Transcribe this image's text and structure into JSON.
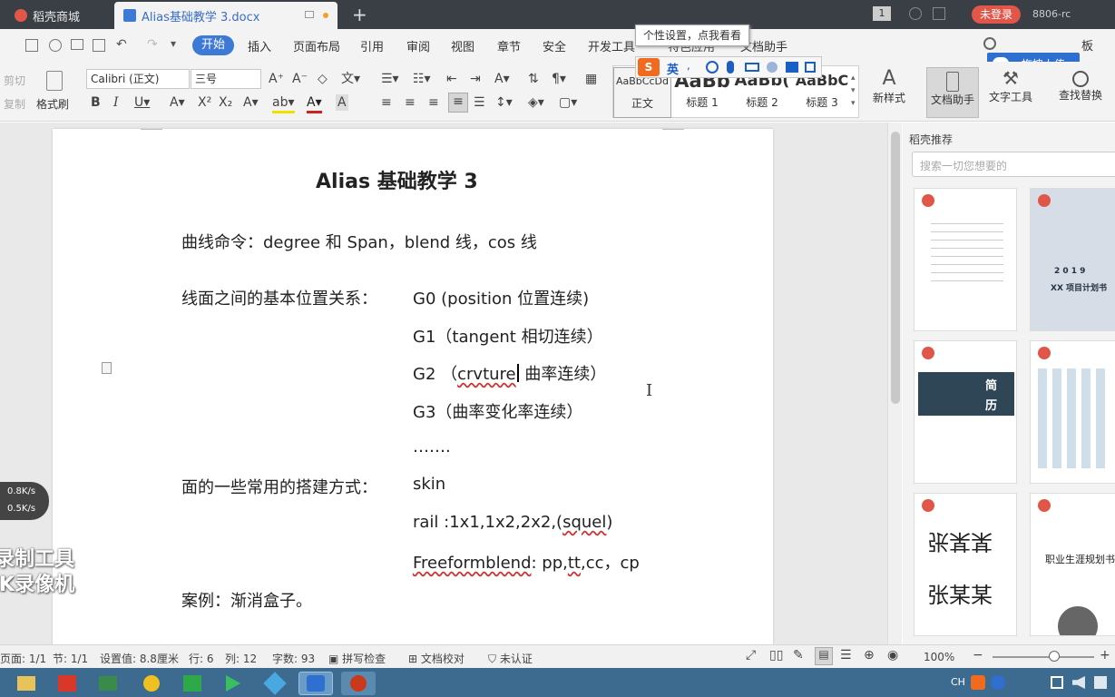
{
  "tabs": [
    {
      "label": "稻壳商城"
    },
    {
      "label": "Alias基础教学 3.docx"
    }
  ],
  "window": {
    "login": "未登录",
    "user": "8806-rc",
    "window_count": "1"
  },
  "menu": [
    "开始",
    "插入",
    "页面布局",
    "引用",
    "审阅",
    "视图",
    "章节",
    "安全",
    "开发工具",
    "特色应用",
    "文档助手"
  ],
  "menu_right": {
    "upload": "拖拽上传",
    "board": "板"
  },
  "tooltip": "个性设置，点我看看",
  "ime": {
    "lang": "英"
  },
  "ribbon": {
    "cut": "剪切",
    "copy": "复制",
    "format_brush": "格式刷",
    "font_name": "Calibri (正文)",
    "font_size": "三号",
    "styles": [
      {
        "preview": "AaBbCcDd",
        "name": "正文"
      },
      {
        "preview": "AaBb",
        "name": "标题 1"
      },
      {
        "preview": "AaBb(",
        "name": "标题 2"
      },
      {
        "preview": "AaBbC",
        "name": "标题 3"
      }
    ],
    "new_style": "新样式",
    "doc_assistant": "文档助手",
    "text_tools": "文字工具",
    "find_replace": "查找替换"
  },
  "document": {
    "title": "Alias 基础教学  3",
    "l1": "曲线命令：degree 和 Span，blend 线，cos 线",
    "l2_label": "线面之间的基本位置关系：",
    "g0": "G0 (position 位置连续)",
    "g1": "G1（tangent 相切连续）",
    "g2_pre": "G2 （",
    "g2_word": "crvture",
    "g2_post": " 曲率连续）",
    "g3": "G3（曲率变化率连续）",
    "dots": "…….",
    "l3_label": "面的一些常用的搭建方式：",
    "skin": "skin",
    "rail_pre": "rail :1x1,1x2,2x2,(",
    "rail_word": "squel",
    "rail_post": ")",
    "ff_word": "Freeformblend",
    "ff_mid": ": pp,",
    "ff_tt": "tt",
    "ff_post": ",cc，cp",
    "case": "案例：渐消盒子。"
  },
  "pane": {
    "title": "稻壳推荐",
    "search_placeholder": "搜索一切您想要的",
    "t2_year": "2 0 1 9",
    "t2_sub": "XX 项目计划书",
    "t3_a": "简",
    "t3_b": "历",
    "t5_a": "张某某",
    "t5_b": "张某某",
    "t6": "职业生涯规划书"
  },
  "status": {
    "page": "页面: 1/1",
    "section": "节: 1/1",
    "setting": "设置值: 8.8厘米",
    "row": "行: 6",
    "col": "列: 12",
    "words": "字数: 93",
    "spell": "拼写检查",
    "proof": "文档校对",
    "cert": "未认证",
    "zoom": "100%"
  },
  "net": {
    "up": "0.8K/s",
    "down": "0.5K/s"
  },
  "watermark": {
    "l1": "录制工具",
    "l2": "KK录像机"
  },
  "tray": {
    "lang": "CH"
  },
  "colors": {
    "accent": "#2f6fd0",
    "start_tab": "#3d7ad6",
    "login_btn": "#e0574a",
    "tabbar": "#3a3f46",
    "taskbar": "#3d6a8f"
  }
}
